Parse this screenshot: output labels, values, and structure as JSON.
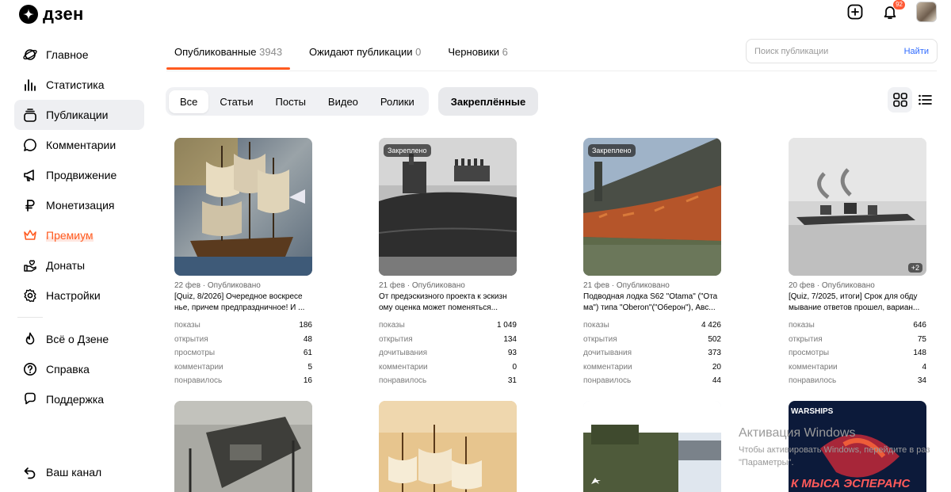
{
  "header": {
    "logo_text": "дзен",
    "notif_count": "92",
    "icons": [
      "add-icon",
      "bell-icon"
    ]
  },
  "sidebar": {
    "items": [
      {
        "label": "Главное",
        "icon": "planet-icon"
      },
      {
        "label": "Статистика",
        "icon": "bars-icon"
      },
      {
        "label": "Публикации",
        "icon": "stack-icon"
      },
      {
        "label": "Комментарии",
        "icon": "comment-icon"
      },
      {
        "label": "Продвижение",
        "icon": "megaphone-icon"
      },
      {
        "label": "Монетизация",
        "icon": "ruble-icon"
      },
      {
        "label": "Премиум",
        "icon": "crown-icon"
      },
      {
        "label": "Донаты",
        "icon": "donate-icon"
      },
      {
        "label": "Настройки",
        "icon": "gear-icon"
      }
    ],
    "extra": [
      {
        "label": "Всё о Дзене",
        "icon": "flame-icon"
      },
      {
        "label": "Справка",
        "icon": "question-icon"
      },
      {
        "label": "Поддержка",
        "icon": "chat-icon"
      }
    ],
    "channel_label": "Ваш канал"
  },
  "tabs": [
    {
      "label": "Опубликованные",
      "count": "3943"
    },
    {
      "label": "Ожидают публикации",
      "count": "0"
    },
    {
      "label": "Черновики",
      "count": "6"
    }
  ],
  "search": {
    "placeholder": "Поиск публикации",
    "button": "Найти"
  },
  "filters": [
    "Все",
    "Статьи",
    "Посты",
    "Видео",
    "Ролики"
  ],
  "pinned_filter": "Закреплённые",
  "cards": [
    {
      "date_status": "22 фев · Опубликовано",
      "title": "[Quiz, 8/2026] Очередное воскресе нье, причем предпраздничное! И ...",
      "badge": "",
      "stats": [
        {
          "k": "показы",
          "v": "186"
        },
        {
          "k": "открытия",
          "v": "48"
        },
        {
          "k": "просмотры",
          "v": "61"
        },
        {
          "k": "комментарии",
          "v": "5"
        },
        {
          "k": "понравилось",
          "v": "16"
        }
      ]
    },
    {
      "date_status": "21 фев · Опубликовано",
      "title": "От предэскизного проекта к эскизн ому оценка может поменяться...",
      "badge": "Закреплено",
      "stats": [
        {
          "k": "показы",
          "v": "1 049"
        },
        {
          "k": "открытия",
          "v": "134"
        },
        {
          "k": "дочитывания",
          "v": "93"
        },
        {
          "k": "комментарии",
          "v": "0"
        },
        {
          "k": "понравилось",
          "v": "31"
        }
      ]
    },
    {
      "date_status": "21 фев · Опубликовано",
      "title": "Подводная лодка S62 \"Otama\" (\"Ота ма\") типа \"Oberon\"(\"Оберон\"), Авс...",
      "badge": "Закреплено",
      "stats": [
        {
          "k": "показы",
          "v": "4 426"
        },
        {
          "k": "открытия",
          "v": "502"
        },
        {
          "k": "дочитывания",
          "v": "373"
        },
        {
          "k": "комментарии",
          "v": "20"
        },
        {
          "k": "понравилось",
          "v": "44"
        }
      ]
    },
    {
      "date_status": "20 фев · Опубликовано",
      "title": "[Quiz, 7/2025, итоги] Срок для обду мывание ответов прошел, вариан...",
      "badge": "",
      "plus": "+2",
      "stats": [
        {
          "k": "показы",
          "v": "646"
        },
        {
          "k": "открытия",
          "v": "75"
        },
        {
          "k": "просмотры",
          "v": "148"
        },
        {
          "k": "комментарии",
          "v": "4"
        },
        {
          "k": "понравилось",
          "v": "34"
        }
      ]
    }
  ],
  "second_row_captions": [
    "WARSHIPS",
    "К МЫСА ЭСПЕРАНС"
  ],
  "watermark": {
    "title": "Активация Windows",
    "line1": "Чтобы активировать Windows, перейдите в раз",
    "line2": "\"Параметры\"."
  }
}
